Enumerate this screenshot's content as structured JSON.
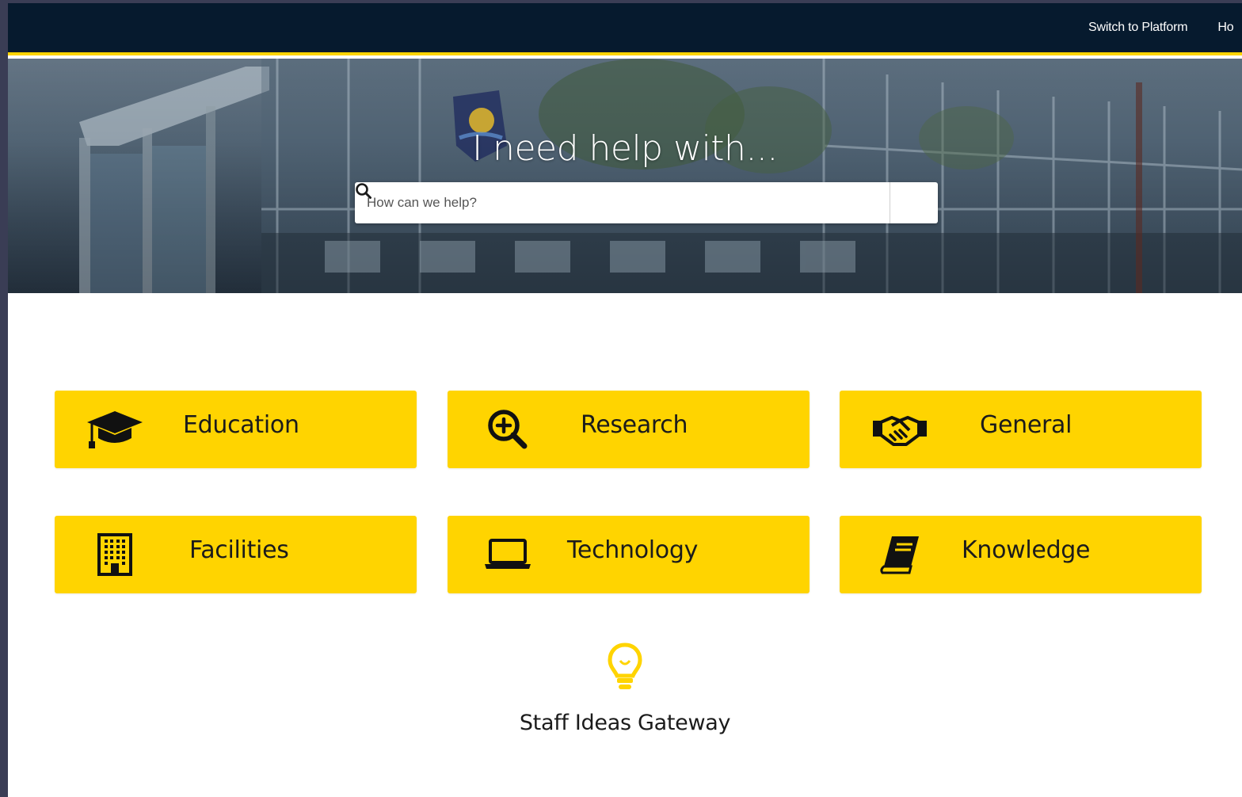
{
  "topnav": {
    "items": [
      {
        "label": "Switch to Platform"
      },
      {
        "label": "Ho"
      }
    ]
  },
  "hero": {
    "title": "I need help with...",
    "search": {
      "placeholder": "How can we help?",
      "value": ""
    }
  },
  "tiles": [
    {
      "label": "Education",
      "icon": "graduation-cap-icon"
    },
    {
      "label": "Research",
      "icon": "zoom-in-icon"
    },
    {
      "label": "General",
      "icon": "handshake-icon"
    },
    {
      "label": "Facilities",
      "icon": "building-icon"
    },
    {
      "label": "Technology",
      "icon": "laptop-icon"
    },
    {
      "label": "Knowledge",
      "icon": "book-icon"
    }
  ],
  "ideas": {
    "label": "Staff Ideas Gateway",
    "icon": "lightbulb-icon"
  },
  "colors": {
    "accent": "#ffd400",
    "header": "#061a2e",
    "text": "#1b1b1b"
  }
}
